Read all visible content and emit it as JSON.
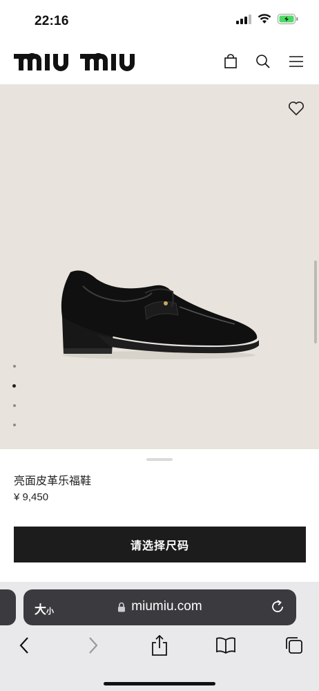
{
  "status": {
    "time": "22:16"
  },
  "header": {
    "brand": "miu miu"
  },
  "product": {
    "name": "亮面皮革乐福鞋",
    "price": "¥ 9,450",
    "cta": "请选择尺码",
    "gallery_total": 4,
    "gallery_active": 2
  },
  "browser": {
    "text_size_big": "大",
    "text_size_small": "小",
    "url": "miumiu.com"
  },
  "colors": {
    "accent": "#1c1c1c",
    "image_bg": "#e8e4dd",
    "battery": "#4cd964"
  },
  "icons": [
    "signal-icon",
    "wifi-icon",
    "battery-icon",
    "bag-icon",
    "search-icon",
    "menu-icon",
    "heart-icon",
    "lock-icon",
    "reload-icon",
    "back-icon",
    "forward-icon",
    "share-icon",
    "bookmarks-icon",
    "tabs-icon"
  ]
}
